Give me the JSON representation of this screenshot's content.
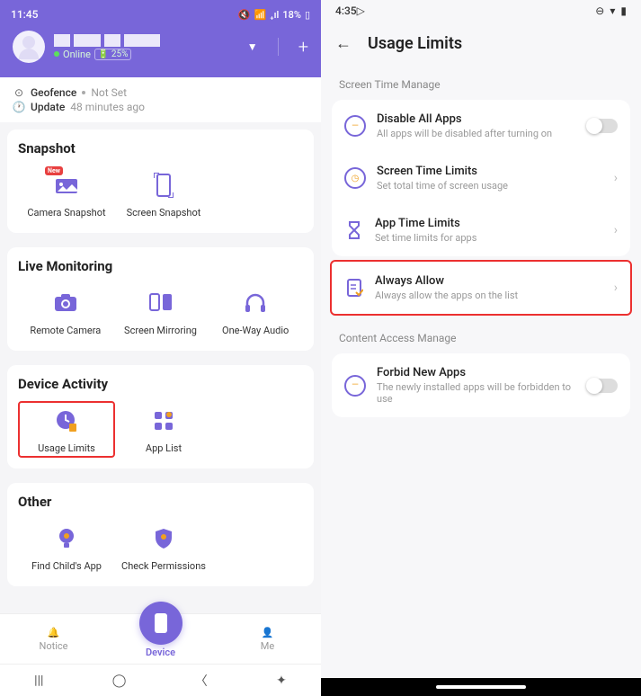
{
  "left": {
    "status": {
      "time": "11:45",
      "battery": "18%",
      "signal": "📶"
    },
    "profile": {
      "online": "Online",
      "battery_pct": "25%"
    },
    "geofence": {
      "label": "Geofence",
      "value": "Not Set"
    },
    "update": {
      "label": "Update",
      "value": "48 minutes ago"
    },
    "snapshot": {
      "title": "Snapshot",
      "new_badge": "New",
      "items": [
        "Camera Snapshot",
        "Screen Snapshot"
      ]
    },
    "live": {
      "title": "Live Monitoring",
      "items": [
        "Remote Camera",
        "Screen Mirroring",
        "One-Way Audio"
      ]
    },
    "activity": {
      "title": "Device Activity",
      "items": [
        "Usage Limits",
        "App List"
      ]
    },
    "other": {
      "title": "Other",
      "items": [
        "Find Child's App",
        "Check Permissions"
      ]
    },
    "nav": {
      "notice": "Notice",
      "device": "Device",
      "me": "Me"
    }
  },
  "right": {
    "status": {
      "time": "4:35"
    },
    "title": "Usage Limits",
    "section1": "Screen Time Manage",
    "rows": [
      {
        "title": "Disable All Apps",
        "sub": "All apps will be disabled after turning on"
      },
      {
        "title": "Screen Time Limits",
        "sub": "Set total time of screen usage"
      },
      {
        "title": "App Time Limits",
        "sub": "Set time limits for apps"
      },
      {
        "title": "Always Allow",
        "sub": "Always allow the apps on the list"
      }
    ],
    "section2": "Content Access Manage",
    "row5": {
      "title": "Forbid New Apps",
      "sub": "The newly installed apps will be forbidden to use"
    }
  }
}
